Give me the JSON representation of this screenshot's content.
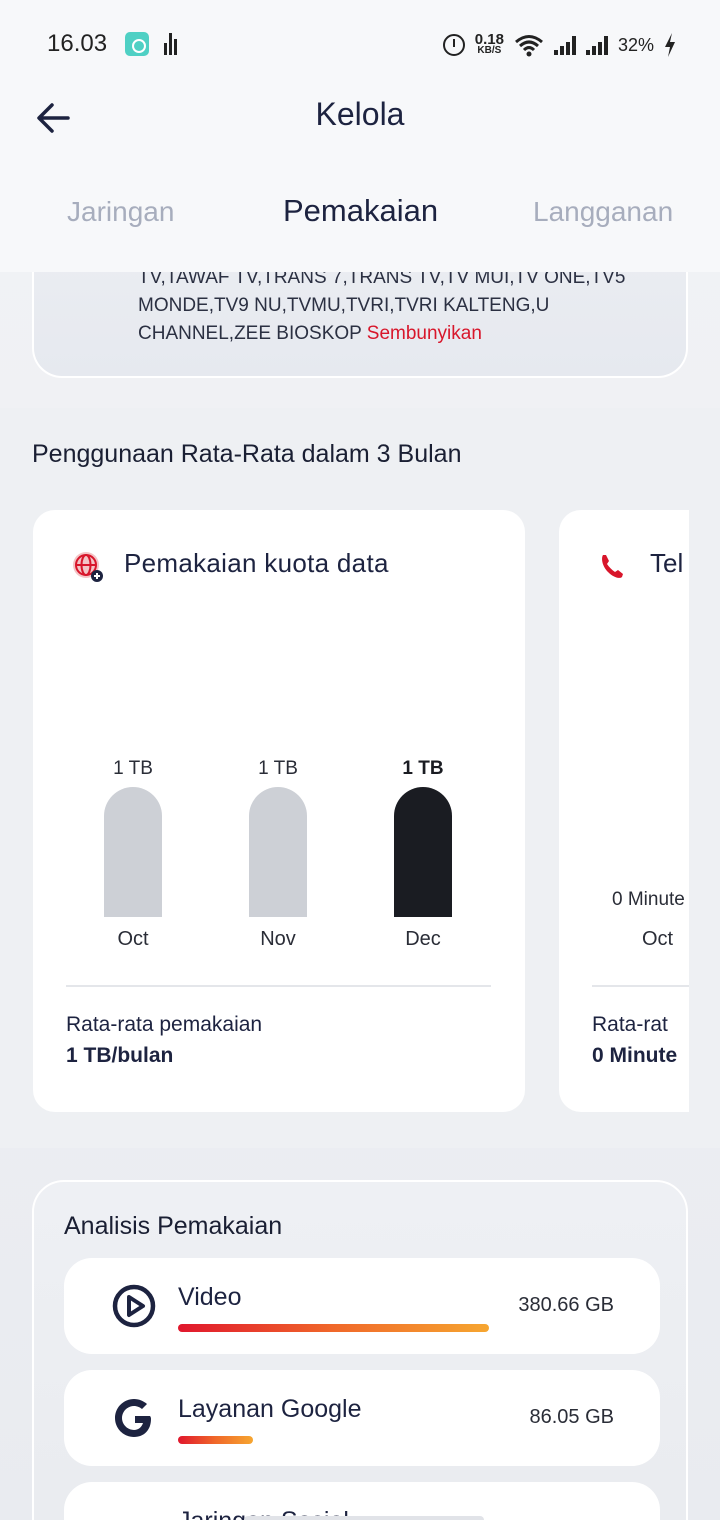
{
  "status_bar": {
    "time": "16.03",
    "net_speed_value": "0.18",
    "net_speed_unit": "KB/S",
    "battery": "32%"
  },
  "header": {
    "title": "Kelola",
    "tabs": [
      "Jaringan",
      "Pemakaian",
      "Langganan"
    ],
    "active_tab": "Pemakaian"
  },
  "channels": {
    "text": "TV,TAWAF TV,TRANS 7,TRANS TV,TV MUI,TV ONE,TV5 MONDE,TV9 NU,TVMU,TVRI,TVRI KALTENG,U CHANNEL,ZEE BIOSKOP",
    "hide_link": "Sembunyikan",
    "hide_link_color": "#d8162b"
  },
  "section_title": "Penggunaan Rata-Rata dalam 3 Bulan",
  "data_card": {
    "title": "Pemakaian kuota data",
    "icon": "globe-data-icon",
    "bars": [
      {
        "month": "Oct",
        "label": "1 TB",
        "highlight": false
      },
      {
        "month": "Nov",
        "label": "1 TB",
        "highlight": false
      },
      {
        "month": "Dec",
        "label": "1 TB",
        "highlight": true
      }
    ],
    "avg_label": "Rata-rata pemakaian",
    "avg_value": "1 TB/bulan"
  },
  "call_card": {
    "title": "Tel",
    "icon": "phone-icon",
    "bar_label": "0 Minute",
    "month": "Oct",
    "avg_label": "Rata-rat",
    "avg_value": "0 Minute"
  },
  "analysis": {
    "title": "Analisis Pemakaian",
    "items": [
      {
        "name": "Video",
        "value": "380.66 GB",
        "fraction": 1.0,
        "icon": "video-play-icon"
      },
      {
        "name": "Layanan Google",
        "value": "86.05 GB",
        "fraction": 0.226,
        "icon": "google-icon"
      },
      {
        "name": "Jaringan Sosial",
        "value": "",
        "icon": "social-icon"
      }
    ]
  },
  "colors": {
    "accent_red": "#d8162b",
    "bar_dark": "#1a1c22",
    "bar_light": "#cdd0d6"
  }
}
